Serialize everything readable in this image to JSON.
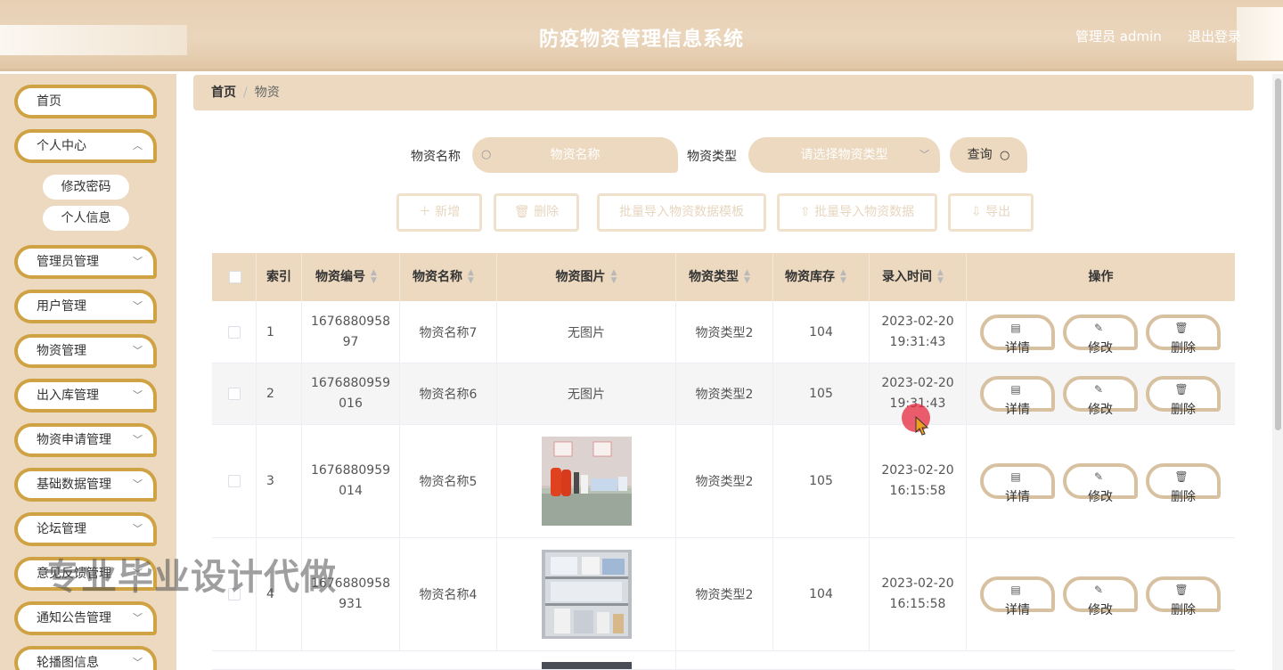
{
  "header": {
    "title": "防疫物资管理信息系统",
    "admin_label": "管理员 admin",
    "logout": "退出登录"
  },
  "sidebar": {
    "home": "首页",
    "personal_center": "个人中心",
    "sub_change_password": "修改密码",
    "sub_personal_info": "个人信息",
    "admin_mgmt": "管理员管理",
    "user_mgmt": "用户管理",
    "material_mgmt": "物资管理",
    "inout_mgmt": "出入库管理",
    "apply_mgmt": "物资申请管理",
    "basic_data_mgmt": "基础数据管理",
    "forum_mgmt": "论坛管理",
    "feedback_mgmt": "意见反馈管理",
    "notice_mgmt": "通知公告管理",
    "carousel_info": "轮播图信息"
  },
  "breadcrumb": {
    "home": "首页",
    "sep": "/",
    "current": "物资"
  },
  "search": {
    "name_label": "物资名称",
    "name_placeholder": "物资名称",
    "type_label": "物资类型",
    "type_placeholder": "请选择物资类型",
    "query_button": "查询"
  },
  "toolbar": {
    "add": "新增",
    "delete": "删除",
    "import_template": "批量导入物资数据模板",
    "import_data": "批量导入物资数据",
    "export": "导出"
  },
  "table": {
    "columns": [
      "索引",
      "物资编号",
      "物资名称",
      "物资图片",
      "物资类型",
      "物资库存",
      "录入时间",
      "操作"
    ],
    "rows": [
      {
        "index": "1",
        "code_a": "1676880958",
        "code_b": "97",
        "name": "物资名称7",
        "image": "无图片",
        "type": "物资类型2",
        "stock": "104",
        "date": "2023-02-20",
        "time": "19:31:43"
      },
      {
        "index": "2",
        "code_a": "1676880959",
        "code_b": "016",
        "name": "物资名称6",
        "image": "无图片",
        "type": "物资类型2",
        "stock": "105",
        "date": "2023-02-20",
        "time": "19:31:43"
      },
      {
        "index": "3",
        "code_a": "1676880959",
        "code_b": "014",
        "name": "物资名称5",
        "image": "",
        "type": "物资类型2",
        "stock": "105",
        "date": "2023-02-20",
        "time": "16:15:58"
      },
      {
        "index": "4",
        "code_a": "1676880958",
        "code_b": "931",
        "name": "物资名称4",
        "image": "",
        "type": "物资类型2",
        "stock": "104",
        "date": "2023-02-20",
        "time": "16:15:58"
      }
    ],
    "actions": {
      "detail": "详情",
      "edit": "修改",
      "delete": "删除"
    }
  },
  "watermark": "专业毕业设计代做",
  "colors": {
    "accent": "#ecd9c0",
    "menu_border": "#cfa343",
    "op_border": "#d8c1a1"
  }
}
